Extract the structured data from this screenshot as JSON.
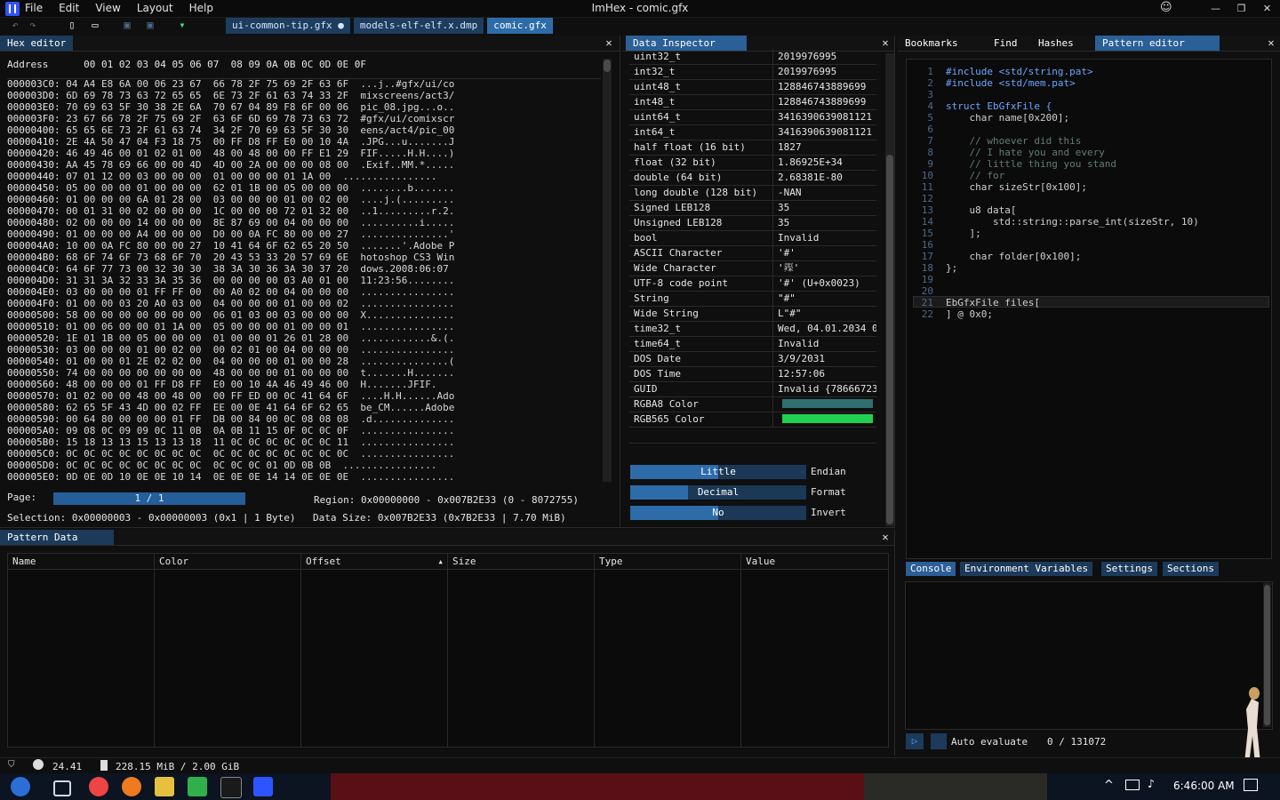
{
  "app": {
    "title": "ImHex - comic.gfx",
    "menu": [
      "File",
      "Edit",
      "View",
      "Layout",
      "Help"
    ],
    "window_controls": {
      "minimize": "—",
      "maximize": "❐",
      "close": "✕"
    },
    "smiley": "☺"
  },
  "toolbar": {
    "tabs": [
      {
        "label": "ui-common-tip.gfx ●",
        "active": false
      },
      {
        "label": "models-elf-elf.x.dmp",
        "active": false
      },
      {
        "label": "comic.gfx",
        "active": true
      }
    ],
    "icons": [
      "undo-icon",
      "redo-icon",
      "new-file-icon",
      "open-file-icon",
      "save-icon",
      "save-as-icon",
      "bookmark-icon"
    ]
  },
  "hex_editor": {
    "title": "Hex editor",
    "address_label": "Address",
    "header_cols": "00 01 02 03 04 05 06 07  08 09 0A 0B 0C 0D 0E 0F",
    "rows": [
      {
        "addr": "000003C0:",
        "hex": "04 A4 E8 6A 00 06 23 67  66 78 2F 75 69 2F 63 6F",
        "ascii": "...j..#gfx/ui/co"
      },
      {
        "addr": "000003D0:",
        "hex": "6D 69 78 73 63 72 65 65  6E 73 2F 61 63 74 33 2F",
        "ascii": "mixscreens/act3/"
      },
      {
        "addr": "000003E0:",
        "hex": "70 69 63 5F 30 38 2E 6A  70 67 04 89 F8 6F 00 06",
        "ascii": "pic_08.jpg...o.."
      },
      {
        "addr": "000003F0:",
        "hex": "23 67 66 78 2F 75 69 2F  63 6F 6D 69 78 73 63 72",
        "ascii": "#gfx/ui/comixscr"
      },
      {
        "addr": "00000400:",
        "hex": "65 65 6E 73 2F 61 63 74  34 2F 70 69 63 5F 30 30",
        "ascii": "eens/act4/pic_00"
      },
      {
        "addr": "00000410:",
        "hex": "2E 4A 50 47 04 F3 18 75  00 FF D8 FF E0 00 10 4A",
        "ascii": ".JPG...u.......J"
      },
      {
        "addr": "00000420:",
        "hex": "46 49 46 00 01 02 01 00  48 00 48 00 00 FF E1 29",
        "ascii": "FIF.....H.H....)"
      },
      {
        "addr": "00000430:",
        "hex": "AA 45 78 69 66 00 00 4D  4D 00 2A 00 00 00 08 00",
        "ascii": ".Exif..MM.*....."
      },
      {
        "addr": "00000440:",
        "hex": "07 01 12 00 03 00 00 00  01 00 00 00 01 1A 00",
        "ascii": "................"
      },
      {
        "addr": "00000450:",
        "hex": "05 00 00 00 01 00 00 00  62 01 1B 00 05 00 00 00",
        "ascii": "........b......."
      },
      {
        "addr": "00000460:",
        "hex": "01 00 00 00 6A 01 28 00  03 00 00 00 01 00 02 00",
        "ascii": "....j.(........."
      },
      {
        "addr": "00000470:",
        "hex": "00 01 31 00 02 00 00 00  1C 00 00 00 72 01 32 00",
        "ascii": "..1.........r.2."
      },
      {
        "addr": "00000480:",
        "hex": "02 00 00 00 14 00 00 00  8E 87 69 00 04 00 00 00",
        "ascii": "..........i....."
      },
      {
        "addr": "00000490:",
        "hex": "01 00 00 00 A4 00 00 00  D0 00 0A FC 80 00 00 27",
        "ascii": "...............'"
      },
      {
        "addr": "000004A0:",
        "hex": "10 00 0A FC 80 00 00 27  10 41 64 6F 62 65 20 50",
        "ascii": ".......'.Adobe P"
      },
      {
        "addr": "000004B0:",
        "hex": "68 6F 74 6F 73 68 6F 70  20 43 53 33 20 57 69 6E",
        "ascii": "hotoshop CS3 Win"
      },
      {
        "addr": "000004C0:",
        "hex": "64 6F 77 73 00 32 30 30  38 3A 30 36 3A 30 37 20",
        "ascii": "dows.2008:06:07 "
      },
      {
        "addr": "000004D0:",
        "hex": "31 31 3A 32 33 3A 35 36  00 00 00 00 03 A0 01 00",
        "ascii": "11:23:56........"
      },
      {
        "addr": "000004E0:",
        "hex": "03 00 00 00 01 FF FF 00  00 A0 02 00 04 00 00 00",
        "ascii": "................"
      },
      {
        "addr": "000004F0:",
        "hex": "01 00 00 03 20 A0 03 00  04 00 00 00 01 00 00 02",
        "ascii": "................"
      },
      {
        "addr": "00000500:",
        "hex": "58 00 00 00 00 00 00 00  06 01 03 00 03 00 00 00",
        "ascii": "X..............."
      },
      {
        "addr": "00000510:",
        "hex": "01 00 06 00 00 01 1A 00  05 00 00 00 01 00 00 01",
        "ascii": "................"
      },
      {
        "addr": "00000520:",
        "hex": "1E 01 1B 00 05 00 00 00  01 00 00 01 26 01 28 00",
        "ascii": "............&.(."
      },
      {
        "addr": "00000530:",
        "hex": "03 00 00 00 01 00 02 00  00 02 01 00 04 00 00 00",
        "ascii": "................"
      },
      {
        "addr": "00000540:",
        "hex": "01 00 00 01 2E 02 02 00  04 00 00 00 01 00 00 28",
        "ascii": "...............("
      },
      {
        "addr": "00000550:",
        "hex": "74 00 00 00 00 00 00 00  48 00 00 00 01 00 00 00",
        "ascii": "t.......H......."
      },
      {
        "addr": "00000560:",
        "hex": "48 00 00 00 01 FF D8 FF  E0 00 10 4A 46 49 46 00",
        "ascii": "H.......JFIF."
      },
      {
        "addr": "00000570:",
        "hex": "01 02 00 00 48 00 48 00  00 FF ED 00 0C 41 64 6F",
        "ascii": "....H.H......Ado"
      },
      {
        "addr": "00000580:",
        "hex": "62 65 5F 43 4D 00 02 FF  EE 00 0E 41 64 6F 62 65",
        "ascii": "be_CM......Adobe"
      },
      {
        "addr": "00000590:",
        "hex": "00 64 80 00 00 00 01 FF  DB 00 84 00 0C 08 08 08",
        "ascii": ".d.............."
      },
      {
        "addr": "000005A0:",
        "hex": "09 08 0C 09 09 0C 11 0B  0A 0B 11 15 0F 0C 0C 0F",
        "ascii": "................"
      },
      {
        "addr": "000005B0:",
        "hex": "15 18 13 13 15 13 13 18  11 0C 0C 0C 0C 0C 0C 11",
        "ascii": "................"
      },
      {
        "addr": "000005C0:",
        "hex": "0C 0C 0C 0C 0C 0C 0C 0C  0C 0C 0C 0C 0C 0C 0C 0C",
        "ascii": "................"
      },
      {
        "addr": "000005D0:",
        "hex": "0C 0C 0C 0C 0C 0C 0C 0C  0C 0C 0C 01 0D 0B 0B",
        "ascii": "................"
      },
      {
        "addr": "000005E0:",
        "hex": "0D 0E 0D 10 0E 0E 10 14  0E 0E 0E 14 14 0E 0E 0E",
        "ascii": "................"
      }
    ],
    "page_label": "Page:",
    "page_value": "1 / 1",
    "region": "Region: 0x00000000 - 0x007B2E33 (0 - 8072755)",
    "selection": "Selection: 0x00000003 - 0x00000003 (0x1 | 1 Byte)",
    "data_size": "Data Size: 0x007B2E33 (0x7B2E33 | 7.70 MiB)"
  },
  "data_inspector": {
    "title": "Data Inspector",
    "rows": [
      {
        "k": "uint32_t",
        "v": "2019976995"
      },
      {
        "k": "int32_t",
        "v": "2019976995"
      },
      {
        "k": "uint48_t",
        "v": "128846743889699"
      },
      {
        "k": "int48_t",
        "v": "128846743889699"
      },
      {
        "k": "uint64_t",
        "v": "3416390639081121"
      },
      {
        "k": "int64_t",
        "v": "3416390639081121"
      },
      {
        "k": "half float (16 bit)",
        "v": "1827"
      },
      {
        "k": "float (32 bit)",
        "v": "1.86925E+34"
      },
      {
        "k": "double (64 bit)",
        "v": "2.68381E-80"
      },
      {
        "k": "long double (128 bit)",
        "v": "-NAN"
      },
      {
        "k": "Signed LEB128",
        "v": "35"
      },
      {
        "k": "Unsigned LEB128",
        "v": "35"
      },
      {
        "k": "bool",
        "v": "Invalid"
      },
      {
        "k": "ASCII Character",
        "v": "'#'"
      },
      {
        "k": "Wide Character",
        "v": "'𨐣'"
      },
      {
        "k": "UTF-8 code point",
        "v": "'#' (U+0x0023)"
      },
      {
        "k": "String",
        "v": "\"#\""
      },
      {
        "k": "Wide String",
        "v": "L\"#\""
      },
      {
        "k": "time32_t",
        "v": "Wed, 04.01.2034 0"
      },
      {
        "k": "time64_t",
        "v": "Invalid"
      },
      {
        "k": "DOS Date",
        "v": "3/9/2031"
      },
      {
        "k": "DOS Time",
        "v": "12:57:06"
      },
      {
        "k": "GUID",
        "v": "Invalid {78666723"
      },
      {
        "k": "RGBA8 Color",
        "v": "",
        "color": "#2f6f6f"
      },
      {
        "k": "RGB565 Color",
        "v": "",
        "color": "#20d050"
      }
    ],
    "toggles": [
      {
        "value": "Little",
        "label": "Endian",
        "fill_fraction": 0.5
      },
      {
        "value": "Decimal",
        "label": "Format",
        "fill_fraction": 0.33
      },
      {
        "value": "No",
        "label": "Invert",
        "fill_fraction": 0.5
      }
    ]
  },
  "right_panel": {
    "tabs": [
      {
        "label": "Bookmarks",
        "active": false
      },
      {
        "label": "Find",
        "active": false
      },
      {
        "label": "Hashes",
        "active": false
      },
      {
        "label": "Pattern editor",
        "active": true
      }
    ],
    "code": [
      {
        "n": "1",
        "t": "#include <std/string.pat>"
      },
      {
        "n": "2",
        "t": "#include <std/mem.pat>"
      },
      {
        "n": "3",
        "t": ""
      },
      {
        "n": "4",
        "t": "struct EbGfxFile {"
      },
      {
        "n": "5",
        "t": "    char name[0x200];"
      },
      {
        "n": "6",
        "t": ""
      },
      {
        "n": "7",
        "t": "    // whoever did this"
      },
      {
        "n": "8",
        "t": "    // I hate you and every"
      },
      {
        "n": "9",
        "t": "    // little thing you stand"
      },
      {
        "n": "10",
        "t": "    // for"
      },
      {
        "n": "11",
        "t": "    char sizeStr[0x100];"
      },
      {
        "n": "12",
        "t": ""
      },
      {
        "n": "13",
        "t": "    u8 data["
      },
      {
        "n": "14",
        "t": "        std::string::parse_int(sizeStr, 10)"
      },
      {
        "n": "15",
        "t": "    ];"
      },
      {
        "n": "16",
        "t": ""
      },
      {
        "n": "17",
        "t": "    char folder[0x100];"
      },
      {
        "n": "18",
        "t": "};"
      },
      {
        "n": "19",
        "t": ""
      },
      {
        "n": "20",
        "t": ""
      },
      {
        "n": "21",
        "t": "EbGfxFile files["
      },
      {
        "n": "22",
        "t": "] @ 0x0;"
      }
    ]
  },
  "pattern_data": {
    "title": "Pattern Data",
    "columns": [
      "Name",
      "Color",
      "Offset",
      "Size",
      "Type",
      "Value"
    ]
  },
  "console": {
    "tabs": [
      {
        "label": "Console",
        "active": true
      },
      {
        "label": "Environment Variables",
        "active": false
      },
      {
        "label": "Settings",
        "active": false
      },
      {
        "label": "Sections",
        "active": false
      }
    ],
    "auto_evaluate": "Auto evaluate",
    "counter": "0 / 131072"
  },
  "statusbar": {
    "fps": "24.41",
    "memory": "228.15 MiB / 2.00 GiB"
  },
  "taskbar": {
    "clock": "6:46:00 AM"
  }
}
